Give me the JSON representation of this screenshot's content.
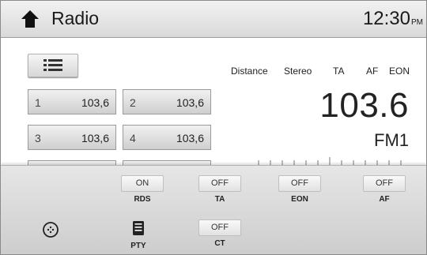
{
  "header": {
    "title": "Radio",
    "time": "12:30",
    "ampm": "PM"
  },
  "presets": [
    {
      "num": "1",
      "freq": "103,6"
    },
    {
      "num": "2",
      "freq": "103,6"
    },
    {
      "num": "3",
      "freq": "103,6"
    },
    {
      "num": "4",
      "freq": "103,6"
    }
  ],
  "flags": {
    "distance": "Distance",
    "stereo": "Stereo",
    "ta": "TA",
    "af": "AF",
    "eon": "EON"
  },
  "tuner": {
    "frequency": "103.6",
    "band": "FM1"
  },
  "settings": {
    "rds": {
      "state": "ON",
      "label": "RDS"
    },
    "ta": {
      "state": "OFF",
      "label": "TA"
    },
    "eon": {
      "state": "OFF",
      "label": "EON"
    },
    "af": {
      "state": "OFF",
      "label": "AF"
    },
    "pty": {
      "label": "PTY"
    },
    "ct": {
      "state": "OFF",
      "label": "CT"
    }
  },
  "icons": {
    "home": "home-icon",
    "list": "list-icon",
    "scan": "scan-icon",
    "pty": "pty-icon"
  }
}
